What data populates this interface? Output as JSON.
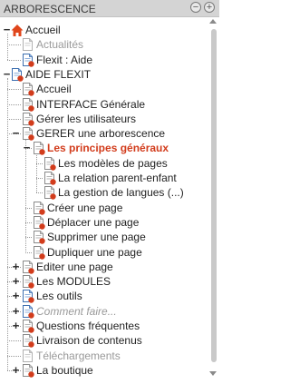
{
  "header": {
    "title": "ARBORESCENCE",
    "collapse_symbol": "−",
    "expand_symbol": "+"
  },
  "colors": {
    "accent": "#d23c1c",
    "doc_blue": "#3d6fb0",
    "home_orange": "#e0461b",
    "grey_text": "#9a9a9a"
  },
  "tree": [
    {
      "label": "Accueil",
      "level": 0,
      "icon": "home-icon",
      "toggle": "−",
      "style": "normal"
    },
    {
      "label": "Actualités",
      "level": 1,
      "icon": "doc-grey-icon",
      "style": "grey"
    },
    {
      "label": "Flexit : Aide",
      "level": 1,
      "icon": "doc-blue-icon",
      "style": "normal"
    },
    {
      "label": "AIDE FLEXIT",
      "level": 0,
      "icon": "doc-blue-icon",
      "toggle": "−",
      "style": "normal"
    },
    {
      "label": "Accueil",
      "level": 1,
      "icon": "doc-red-icon",
      "style": "normal"
    },
    {
      "label": "INTERFACE Générale",
      "level": 1,
      "icon": "doc-red-icon",
      "style": "normal"
    },
    {
      "label": "Gérer les utilisateurs",
      "level": 1,
      "icon": "doc-red-icon",
      "style": "normal"
    },
    {
      "label": "GERER une arborescence",
      "level": 1,
      "icon": "doc-red-icon",
      "toggle": "−",
      "style": "normal"
    },
    {
      "label": "Les principes généraux",
      "level": 2,
      "icon": "doc-red-icon",
      "toggle": "−",
      "style": "active"
    },
    {
      "label": "Les modèles de pages",
      "level": 3,
      "icon": "doc-red-icon",
      "style": "normal"
    },
    {
      "label": "La relation parent-enfant",
      "level": 3,
      "icon": "doc-red-icon",
      "style": "normal"
    },
    {
      "label": "La gestion de langues (...)",
      "level": 3,
      "icon": "doc-red-icon",
      "style": "normal"
    },
    {
      "label": "Créer une page",
      "level": 2,
      "icon": "doc-red-icon",
      "style": "normal"
    },
    {
      "label": "Déplacer une page",
      "level": 2,
      "icon": "doc-red-icon",
      "style": "normal"
    },
    {
      "label": "Supprimer une page",
      "level": 2,
      "icon": "doc-red-icon",
      "style": "normal"
    },
    {
      "label": "Dupliquer une page",
      "level": 2,
      "icon": "doc-red-icon",
      "style": "normal"
    },
    {
      "label": "Editer une page",
      "level": 1,
      "icon": "doc-red-icon",
      "toggle": "+",
      "style": "normal"
    },
    {
      "label": "Les MODULES",
      "level": 1,
      "icon": "doc-red-icon",
      "toggle": "+",
      "style": "normal"
    },
    {
      "label": "Les outils",
      "level": 1,
      "icon": "doc-blue-icon",
      "toggle": "+",
      "style": "normal"
    },
    {
      "label": "Comment faire...",
      "level": 1,
      "icon": "doc-blue-icon",
      "toggle": "+",
      "style": "grey-it"
    },
    {
      "label": "Questions fréquentes",
      "level": 1,
      "icon": "doc-red-icon",
      "toggle": "+",
      "style": "normal"
    },
    {
      "label": "Livraison de contenus",
      "level": 1,
      "icon": "doc-red-icon",
      "style": "normal"
    },
    {
      "label": "Téléchargements",
      "level": 1,
      "icon": "doc-grey-icon",
      "style": "grey"
    },
    {
      "label": "La boutique",
      "level": 1,
      "icon": "doc-red-icon",
      "toggle": "+",
      "style": "normal"
    }
  ]
}
